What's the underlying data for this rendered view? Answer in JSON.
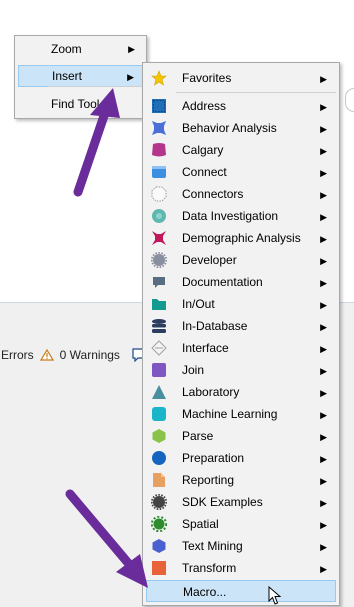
{
  "status": {
    "errors": "Errors",
    "warnings": "0 Warnings"
  },
  "context_menu": {
    "items": [
      {
        "label": "Zoom",
        "has_submenu": true
      },
      {
        "label": "Insert",
        "has_submenu": true
      },
      {
        "label": "Find Tool...",
        "has_submenu": false
      }
    ]
  },
  "insert_menu": {
    "items": [
      {
        "label": "Favorites",
        "icon": "star-icon",
        "color": "#f5c400"
      },
      {
        "label": "Address",
        "icon": "address-icon",
        "color": "#1e6fb8"
      },
      {
        "label": "Behavior Analysis",
        "icon": "behavior-analysis-icon",
        "color": "#4a6fd8"
      },
      {
        "label": "Calgary",
        "icon": "calgary-icon",
        "color": "#b3358c"
      },
      {
        "label": "Connect",
        "icon": "connect-icon",
        "color": "#3b8fe0"
      },
      {
        "label": "Connectors",
        "icon": "connectors-icon",
        "color": "#c0c0c0"
      },
      {
        "label": "Data Investigation",
        "icon": "data-investigation-icon",
        "color": "#5fb8b0"
      },
      {
        "label": "Demographic Analysis",
        "icon": "demographic-analysis-icon",
        "color": "#c2185b"
      },
      {
        "label": "Developer",
        "icon": "developer-icon",
        "color": "#8a8fa0"
      },
      {
        "label": "Documentation",
        "icon": "documentation-icon",
        "color": "#5a6c80"
      },
      {
        "label": "In/Out",
        "icon": "in-out-icon",
        "color": "#139b8f"
      },
      {
        "label": "In-Database",
        "icon": "in-database-icon",
        "color": "#2c3e60"
      },
      {
        "label": "Interface",
        "icon": "interface-icon",
        "color": "#b0b0b0"
      },
      {
        "label": "Join",
        "icon": "join-icon",
        "color": "#7e57c2"
      },
      {
        "label": "Laboratory",
        "icon": "laboratory-icon",
        "color": "#4a8fa0"
      },
      {
        "label": "Machine Learning",
        "icon": "machine-learning-icon",
        "color": "#1ab5c8"
      },
      {
        "label": "Parse",
        "icon": "parse-icon",
        "color": "#8bc34a"
      },
      {
        "label": "Preparation",
        "icon": "preparation-icon",
        "color": "#1565c0"
      },
      {
        "label": "Reporting",
        "icon": "reporting-icon",
        "color": "#e8a060"
      },
      {
        "label": "SDK Examples",
        "icon": "sdk-examples-icon",
        "color": "#444444"
      },
      {
        "label": "Spatial",
        "icon": "spatial-icon",
        "color": "#2e8b2e"
      },
      {
        "label": "Text Mining",
        "icon": "text-mining-icon",
        "color": "#4a5fd0"
      },
      {
        "label": "Transform",
        "icon": "transform-icon",
        "color": "#e8623a"
      },
      {
        "label": "Macro...",
        "icon": "",
        "color": ""
      }
    ]
  },
  "annotation_color": "#6a2c9a",
  "highlight_color": "#cce4f7"
}
